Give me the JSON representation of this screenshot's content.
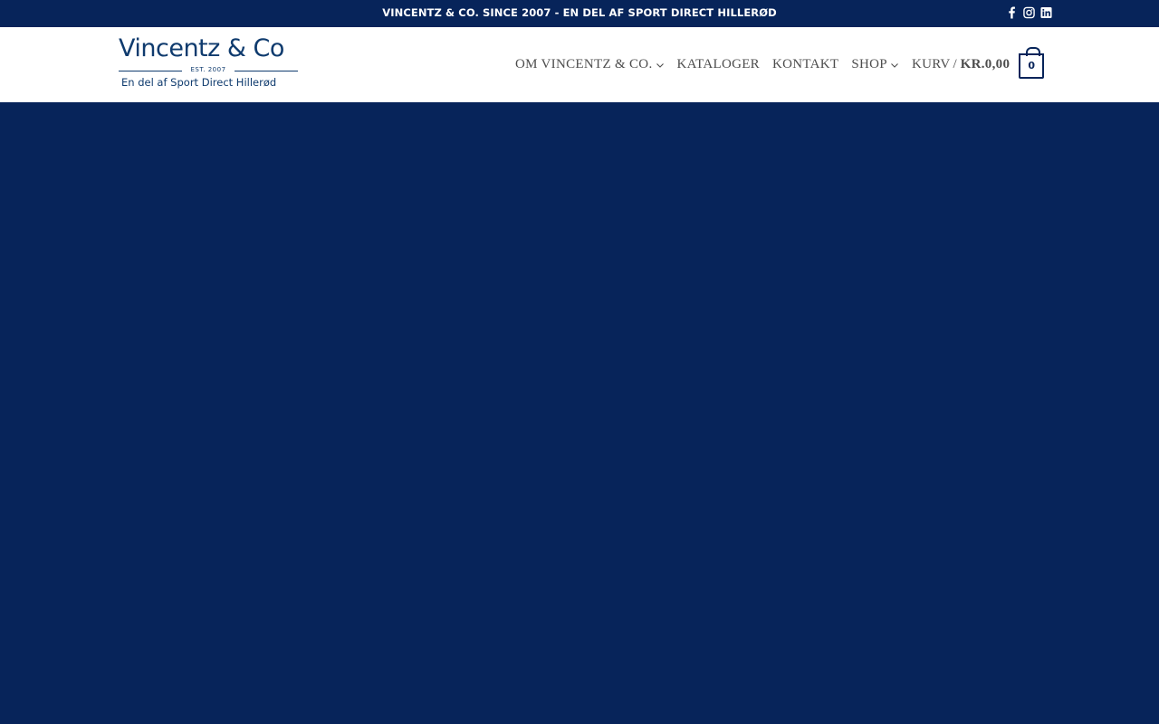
{
  "topbar": {
    "text": "VINCENTZ & CO. SINCE 2007 - EN DEL AF SPORT DIRECT HILLERØD",
    "social": [
      "facebook-icon",
      "instagram-icon",
      "linkedin-icon"
    ]
  },
  "logo": {
    "name": "Vincentz & Co",
    "est": "EST. 2007",
    "tagline": "En del af Sport Direct Hillerød"
  },
  "nav": {
    "items": [
      {
        "label": "OM VINCENTZ & CO.",
        "has_dropdown": true
      },
      {
        "label": "KATALOGER",
        "has_dropdown": false
      },
      {
        "label": "KONTAKT",
        "has_dropdown": false
      },
      {
        "label": "SHOP",
        "has_dropdown": true
      }
    ],
    "cart": {
      "label": "KURV",
      "separator": "/",
      "amount": "KR.0,00",
      "count": "0"
    }
  },
  "colors": {
    "brand_navy": "#07245a",
    "logo_blue": "#0f3b6e",
    "nav_text": "#4d4d4d",
    "header_bg": "#ffffff"
  }
}
